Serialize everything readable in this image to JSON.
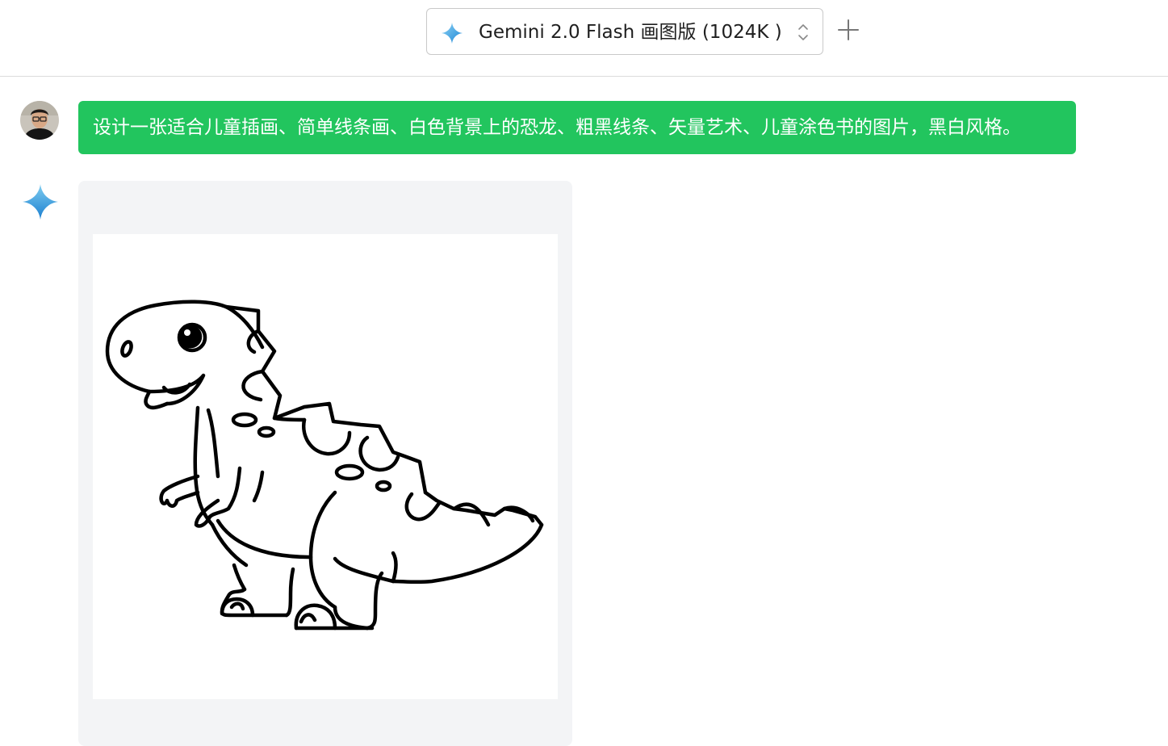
{
  "header": {
    "model_label": "Gemini 2.0 Flash 画图版 (1024K )",
    "model_icon": "gemini-sparkle-icon",
    "add_icon": "plus-icon"
  },
  "conversation": {
    "user_message": "设计一张适合儿童插画、简单线条画、白色背景上的恐龙、粗黑线条、矢量艺术、儿童涂色书的图片，黑白风格。",
    "user_avatar": "user-photo-avatar",
    "assistant_avatar": "gemini-sparkle-icon",
    "assistant_image": "dinosaur-line-art-image"
  },
  "colors": {
    "user_bubble": "#22c55e",
    "assistant_card": "#f3f4f6",
    "sparkle_top": "#6fc3ef",
    "sparkle_bottom": "#1b85d6"
  }
}
